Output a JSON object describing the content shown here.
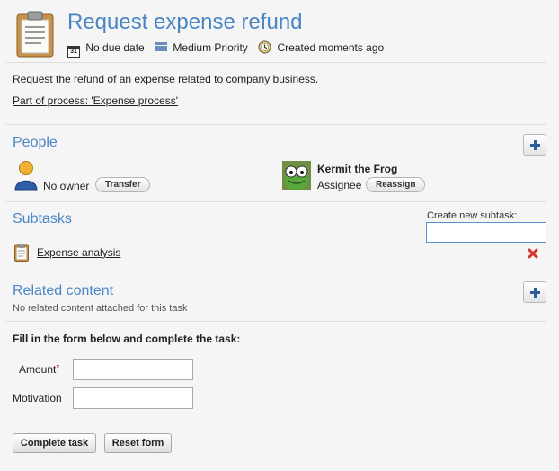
{
  "header": {
    "title": "Request expense refund",
    "due_date": "No due date",
    "priority": "Medium Priority",
    "created": "Created moments ago",
    "calendar_glyph": "31"
  },
  "description": "Request the refund of an expense related to company business.",
  "process_link": "Part of process: 'Expense process'",
  "people": {
    "title": "People",
    "owner_label": "No owner",
    "transfer_button": "Transfer",
    "assignee_name": "Kermit the Frog",
    "assignee_role": "Assignee",
    "reassign_button": "Reassign"
  },
  "subtasks": {
    "title": "Subtasks",
    "create_label": "Create new subtask:",
    "items": [
      {
        "label": "Expense analysis"
      }
    ]
  },
  "related": {
    "title": "Related content",
    "empty_text": "No related content attached for this task"
  },
  "form": {
    "instruction": "Fill in the form below and complete the task:",
    "amount_label": "Amount",
    "required_marker": "*",
    "motivation_label": "Motivation",
    "amount_value": "",
    "motivation_value": ""
  },
  "actions": {
    "complete": "Complete task",
    "reset": "Reset form"
  },
  "colors": {
    "accent": "#4a86c5",
    "required": "#cc0000",
    "delete": "#d9352c"
  }
}
